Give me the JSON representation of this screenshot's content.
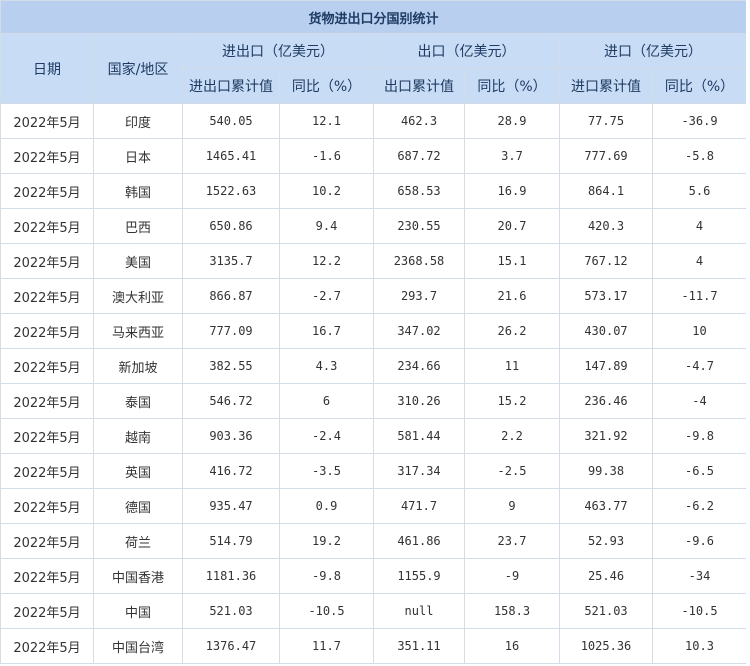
{
  "table": {
    "title": "货物进出口分国别统计",
    "headers": {
      "date": "日期",
      "region": "国家/地区",
      "groups": [
        "进出口（亿美元）",
        "出口（亿美元）",
        "进口（亿美元）"
      ],
      "sub": [
        "进出口累计值",
        "同比（%）",
        "出口累计值",
        "同比（%）",
        "进口累计值",
        "同比（%）"
      ]
    },
    "rows": [
      [
        "2022年5月",
        "印度",
        "540.05",
        "12.1",
        "462.3",
        "28.9",
        "77.75",
        "-36.9"
      ],
      [
        "2022年5月",
        "日本",
        "1465.41",
        "-1.6",
        "687.72",
        "3.7",
        "777.69",
        "-5.8"
      ],
      [
        "2022年5月",
        "韩国",
        "1522.63",
        "10.2",
        "658.53",
        "16.9",
        "864.1",
        "5.6"
      ],
      [
        "2022年5月",
        "巴西",
        "650.86",
        "9.4",
        "230.55",
        "20.7",
        "420.3",
        "4"
      ],
      [
        "2022年5月",
        "美国",
        "3135.7",
        "12.2",
        "2368.58",
        "15.1",
        "767.12",
        "4"
      ],
      [
        "2022年5月",
        "澳大利亚",
        "866.87",
        "-2.7",
        "293.7",
        "21.6",
        "573.17",
        "-11.7"
      ],
      [
        "2022年5月",
        "马来西亚",
        "777.09",
        "16.7",
        "347.02",
        "26.2",
        "430.07",
        "10"
      ],
      [
        "2022年5月",
        "新加坡",
        "382.55",
        "4.3",
        "234.66",
        "11",
        "147.89",
        "-4.7"
      ],
      [
        "2022年5月",
        "泰国",
        "546.72",
        "6",
        "310.26",
        "15.2",
        "236.46",
        "-4"
      ],
      [
        "2022年5月",
        "越南",
        "903.36",
        "-2.4",
        "581.44",
        "2.2",
        "321.92",
        "-9.8"
      ],
      [
        "2022年5月",
        "英国",
        "416.72",
        "-3.5",
        "317.34",
        "-2.5",
        "99.38",
        "-6.5"
      ],
      [
        "2022年5月",
        "德国",
        "935.47",
        "0.9",
        "471.7",
        "9",
        "463.77",
        "-6.2"
      ],
      [
        "2022年5月",
        "荷兰",
        "514.79",
        "19.2",
        "461.86",
        "23.7",
        "52.93",
        "-9.6"
      ],
      [
        "2022年5月",
        "中国香港",
        "1181.36",
        "-9.8",
        "1155.9",
        "-9",
        "25.46",
        "-34"
      ],
      [
        "2022年5月",
        "中国",
        "521.03",
        "-10.5",
        "null",
        "158.3",
        "521.03",
        "-10.5"
      ],
      [
        "2022年5月",
        "中国台湾",
        "1376.47",
        "11.7",
        "351.11",
        "16",
        "1025.36",
        "10.3"
      ]
    ]
  },
  "colors": {
    "header_bg": "#c8dcf5",
    "title_bg": "#b8cff0",
    "border": "#d4dce7"
  }
}
